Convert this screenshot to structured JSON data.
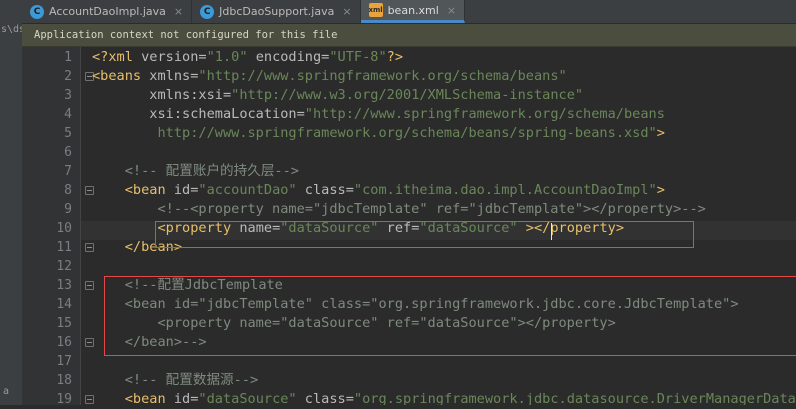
{
  "sidebar": {
    "top_label": "s\\ds",
    "bottom_label": "a"
  },
  "tabs": [
    {
      "label": "AccountDaoImpl.java",
      "icon": "C",
      "kind": "java",
      "active": false
    },
    {
      "label": "JdbcDaoSupport.java",
      "icon": "C",
      "kind": "java",
      "active": false
    },
    {
      "label": "bean.xml",
      "icon": "xml",
      "kind": "xml",
      "active": true
    }
  ],
  "banner": {
    "text": "Application context not configured for this file"
  },
  "line_numbers": [
    "1",
    "2",
    "3",
    "4",
    "5",
    "6",
    "7",
    "8",
    "9",
    "10",
    "11",
    "12",
    "13",
    "14",
    "15",
    "16",
    "17",
    "18",
    "19"
  ],
  "code_lines": [
    [
      [
        "p",
        "<?xml "
      ],
      [
        "a",
        "version="
      ],
      [
        "v",
        "\"1.0\""
      ],
      [
        "a",
        " encoding="
      ],
      [
        "v",
        "\"UTF-8\""
      ],
      [
        "p",
        "?>"
      ]
    ],
    [
      [
        "t",
        "<beans "
      ],
      [
        "a",
        "xmlns="
      ],
      [
        "v",
        "\"http://www.springframework.org/schema/beans\""
      ]
    ],
    [
      [
        "a",
        "       xmlns:xsi="
      ],
      [
        "v",
        "\"http://www.w3.org/2001/XMLSchema-instance\""
      ]
    ],
    [
      [
        "a",
        "       xsi:schemaLocation="
      ],
      [
        "v",
        "\"http://www.springframework.org/schema/beans"
      ]
    ],
    [
      [
        "v",
        "        http://www.springframework.org/schema/beans/spring-beans.xsd\""
      ],
      [
        "t",
        ">"
      ]
    ],
    [],
    [
      [
        "c",
        "    <!-- 配置账户的持久层-->"
      ]
    ],
    [
      [
        "t",
        "    <bean "
      ],
      [
        "a",
        "id="
      ],
      [
        "v",
        "\"accountDao\""
      ],
      [
        "a",
        " class="
      ],
      [
        "v",
        "\"com.itheima.dao.impl.AccountDaoImpl\""
      ],
      [
        "t",
        ">"
      ]
    ],
    [
      [
        "c",
        "        <!--<property name=\"jdbcTemplate\" ref=\"jdbcTemplate\"></property>-->"
      ]
    ],
    [
      [
        "t",
        "        <property "
      ],
      [
        "a",
        "name="
      ],
      [
        "v",
        "\"dataSource\""
      ],
      [
        "a",
        " ref="
      ],
      [
        "v",
        "\"dataSource\""
      ],
      [
        "t",
        " ></property>"
      ]
    ],
    [
      [
        "t",
        "    </bean>"
      ]
    ],
    [],
    [
      [
        "c",
        "    <!--配置JdbcTemplate"
      ]
    ],
    [
      [
        "c",
        "    <bean id=\"jdbcTemplate\" class=\"org.springframework.jdbc.core.JdbcTemplate\">"
      ]
    ],
    [
      [
        "c",
        "        <property name=\"dataSource\" ref=\"dataSource\"></property>"
      ]
    ],
    [
      [
        "c",
        "    </bean>-->"
      ]
    ],
    [],
    [
      [
        "c",
        "    <!-- 配置数据源-->"
      ]
    ],
    [
      [
        "t",
        "    <bean "
      ],
      [
        "a",
        "id="
      ],
      [
        "v",
        "\"dataSource\""
      ],
      [
        "a",
        " class="
      ],
      [
        "v",
        "\"org.springframework.jdbc.datasource.DriverManagerDataSource\""
      ],
      [
        "t",
        ">"
      ]
    ]
  ],
  "folds": [
    2,
    8,
    11,
    13,
    16,
    19
  ],
  "colors": {
    "tag": "#e8bf6a",
    "attribute": "#bababa",
    "value": "#6a8759",
    "comment": "#7f8a7f",
    "annotation_box": "#e54747",
    "active_tab_underline": "#4a88c7"
  }
}
